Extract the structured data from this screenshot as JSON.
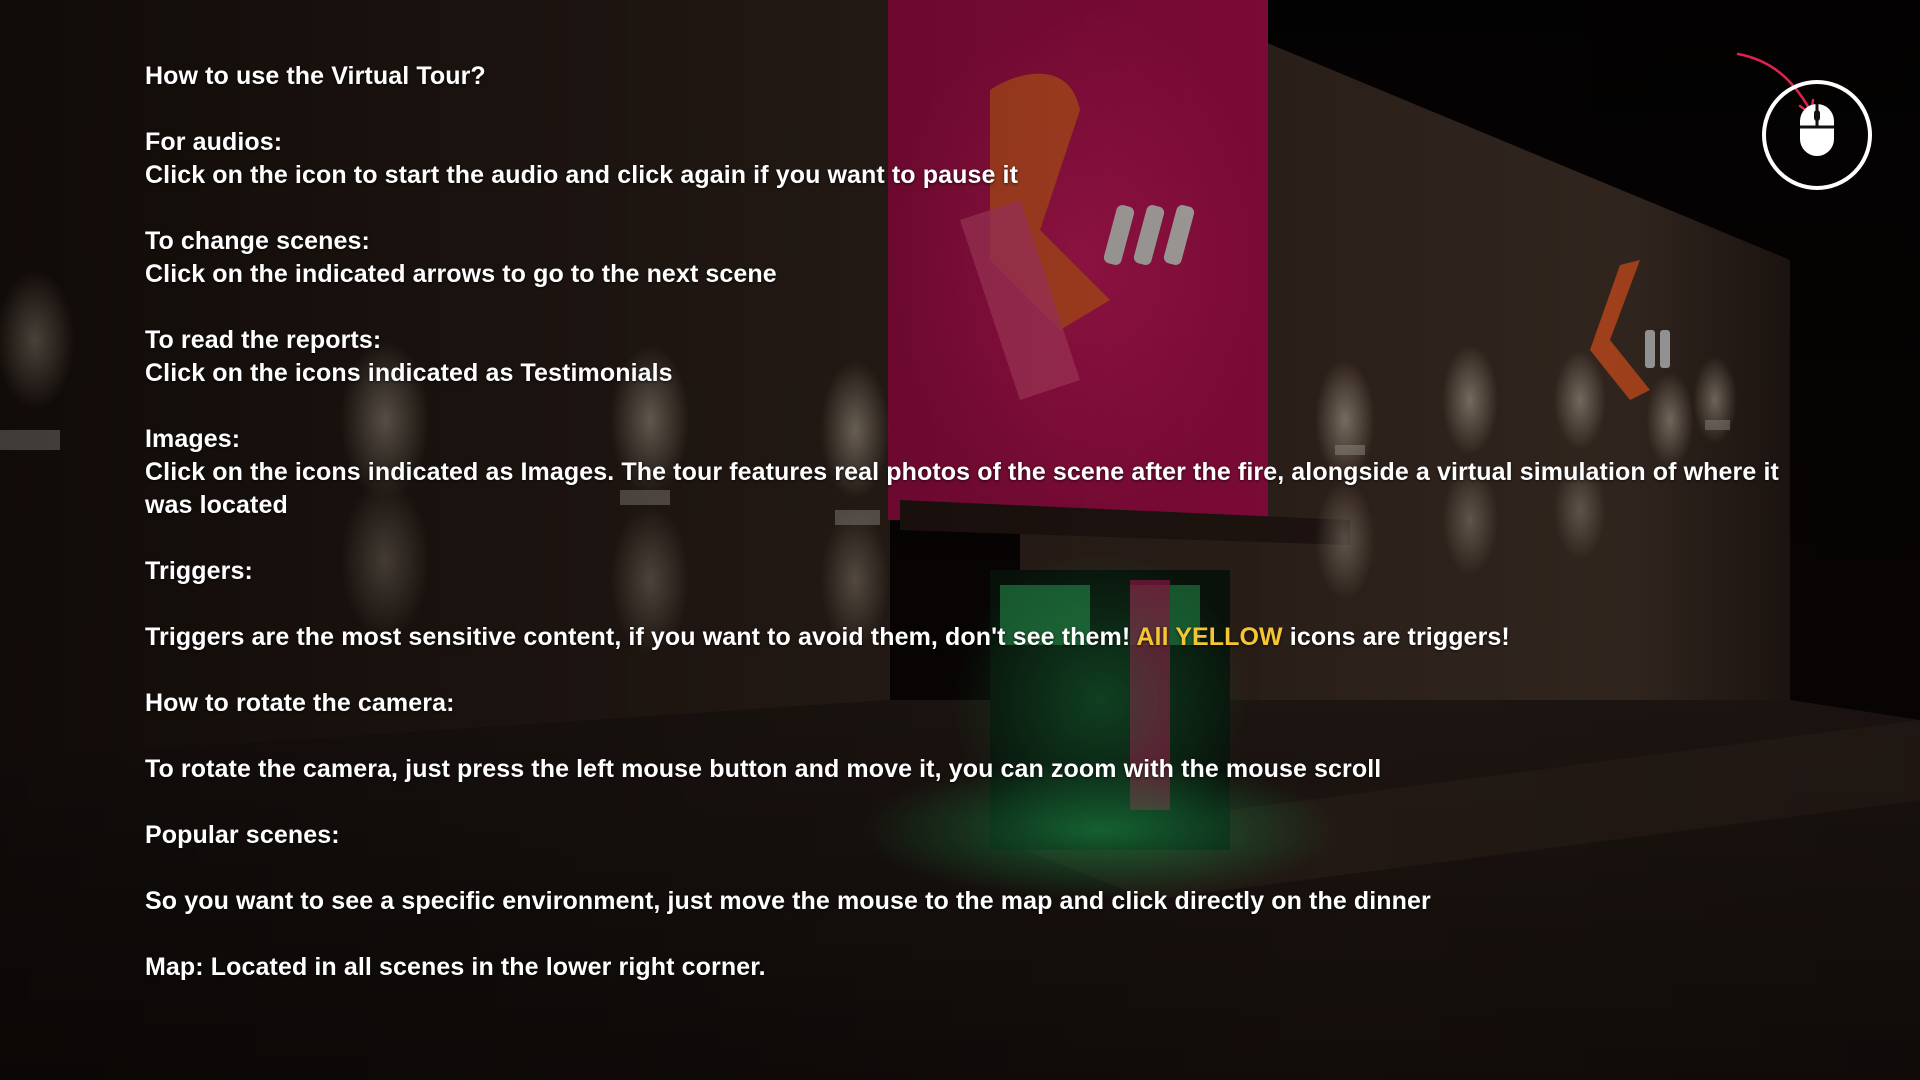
{
  "colors": {
    "text": "#ffffff",
    "highlight": "#f6c533",
    "hint_arrow": "#e0224f",
    "sign_pink": "#c4135a",
    "sign_orange": "#f0602a",
    "door_green": "#1fa14a"
  },
  "icons": {
    "mouse_hint": "mouse-icon",
    "hint_arrow": "curved-arrow-icon"
  },
  "instructions": {
    "title": "How to use the Virtual Tour?",
    "audios": {
      "heading": "For audios:",
      "text": "Click on the icon to start the audio and click again if you want to pause it"
    },
    "scenes": {
      "heading": "To change scenes:",
      "text": "Click on the indicated arrows to go to the next scene"
    },
    "reports": {
      "heading": "To read the reports:",
      "text": "Click on the icons indicated as Testimonials"
    },
    "images": {
      "heading": "Images:",
      "text": "Click on the icons indicated as Images. The tour features real photos of the scene after the fire, alongside a virtual simulation of where it was located"
    },
    "triggers": {
      "heading": "Triggers:",
      "text_before": "Triggers are the most sensitive content, if you want to avoid them, don't see them! ",
      "highlight": "All YELLOW",
      "text_after": " icons are triggers!"
    },
    "camera": {
      "heading": "How to rotate the camera:",
      "text": "To rotate the camera, just press the left mouse button and move it, you can zoom with the mouse scroll"
    },
    "popular": {
      "heading": "Popular scenes:",
      "text": "So you want to see a specific environment, just move the mouse to the map and click directly on the dinner"
    },
    "map": {
      "text": "Map: Located in all scenes in the lower right corner."
    }
  }
}
